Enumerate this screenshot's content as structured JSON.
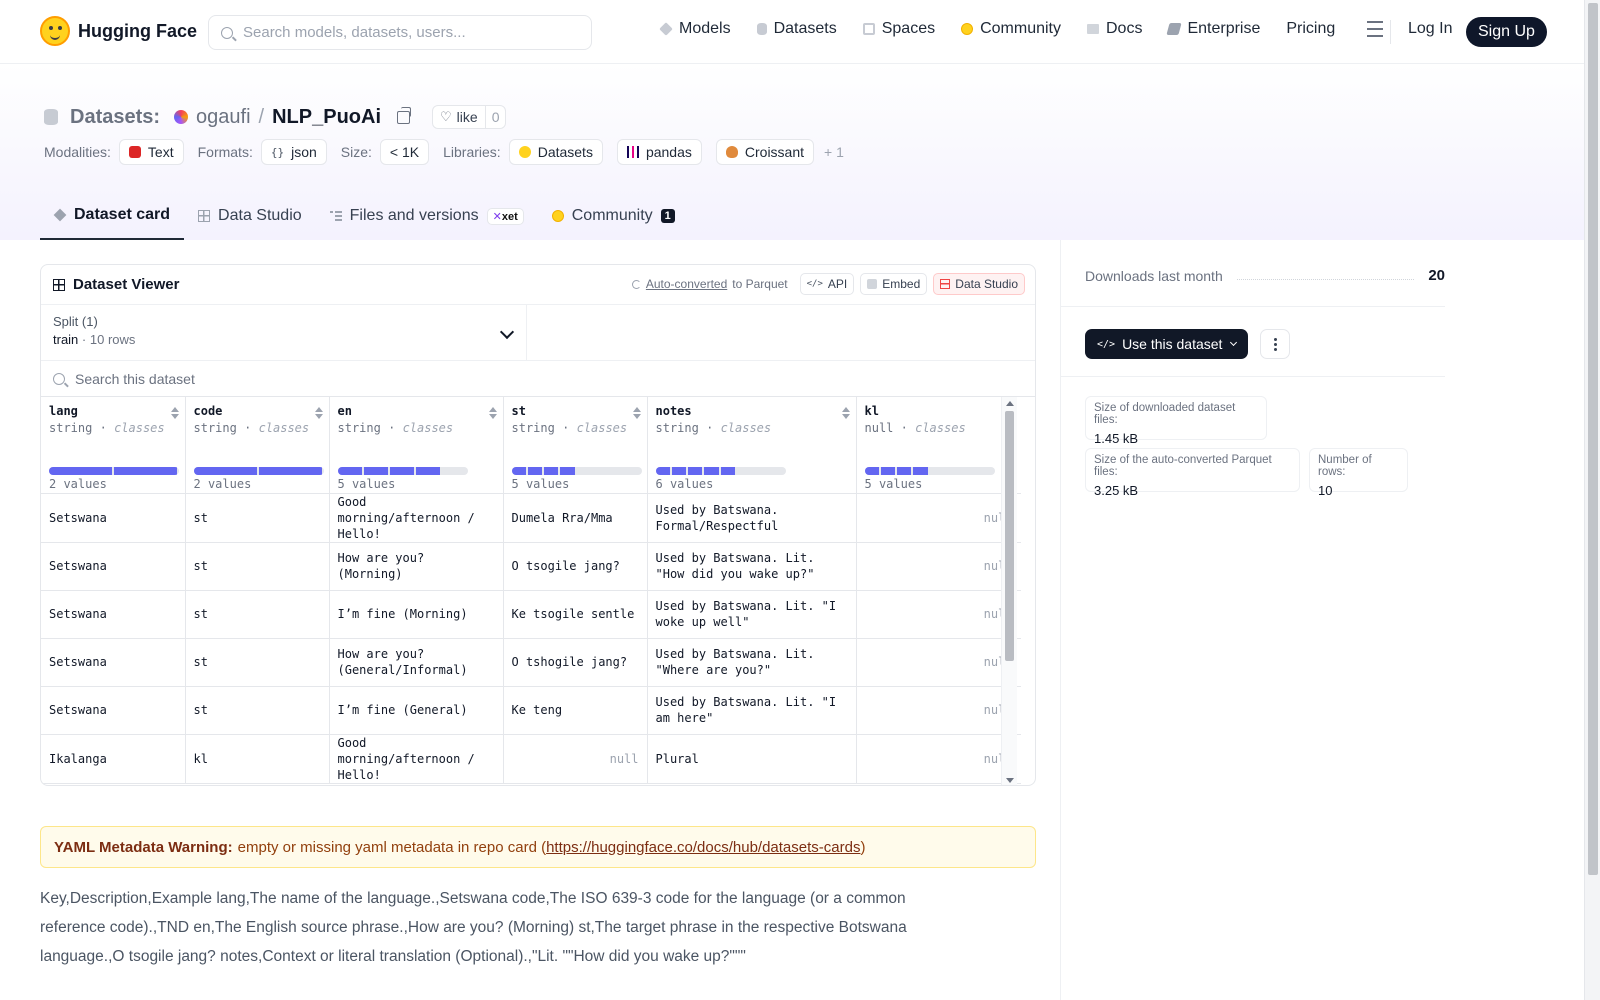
{
  "brand": {
    "name": "Hugging Face"
  },
  "search": {
    "placeholder": "Search models, datasets, users..."
  },
  "nav": {
    "links": [
      {
        "label": "Models",
        "icon": "cube-icon"
      },
      {
        "label": "Datasets",
        "icon": "database-icon"
      },
      {
        "label": "Spaces",
        "icon": "grid-icon"
      },
      {
        "label": "Community",
        "icon": "hf-face-icon"
      },
      {
        "label": "Docs",
        "icon": "book-icon"
      },
      {
        "label": "Enterprise",
        "icon": "building-icon"
      },
      {
        "label": "Pricing"
      }
    ],
    "login": "Log In",
    "signup": "Sign Up"
  },
  "repo": {
    "prefix": "Datasets:",
    "owner": "ogaufi",
    "separator": "/",
    "name": "NLP_PuoAi",
    "like_label": "like",
    "like_count": "0"
  },
  "tags": {
    "modalities_label": "Modalities:",
    "modalities": [
      "Text"
    ],
    "formats_label": "Formats:",
    "formats": [
      "json"
    ],
    "size_label": "Size:",
    "size": "< 1K",
    "libraries_label": "Libraries:",
    "libraries": [
      "Datasets",
      "pandas",
      "Croissant"
    ],
    "more": "+ 1"
  },
  "tabs": [
    {
      "label": "Dataset card",
      "active": true
    },
    {
      "label": "Data Studio"
    },
    {
      "label": "Files and versions",
      "badge": "xet"
    },
    {
      "label": "Community",
      "count": "1"
    }
  ],
  "viewer": {
    "title": "Dataset Viewer",
    "auto_converted": "Auto-converted",
    "to_parquet": "to Parquet",
    "api": "API",
    "embed": "Embed",
    "data_studio": "Data Studio",
    "split_label": "Split (1)",
    "split_value": "train",
    "split_sep": "·",
    "split_rows": "10 rows",
    "search_placeholder": "Search this dataset",
    "columns": [
      {
        "name": "lang",
        "type": "string",
        "kind": "classes",
        "values": "2 values",
        "segments": 2,
        "total": 2
      },
      {
        "name": "code",
        "type": "string",
        "kind": "classes",
        "values": "2 values",
        "segments": 2,
        "total": 2
      },
      {
        "name": "en",
        "type": "string",
        "kind": "classes",
        "values": "5 values",
        "segments": 4,
        "total": 5
      },
      {
        "name": "st",
        "type": "string",
        "kind": "classes",
        "values": "5 values",
        "segments": 4,
        "total": 8
      },
      {
        "name": "notes",
        "type": "string",
        "kind": "classes",
        "values": "6 values",
        "segments": 5,
        "total": 8
      },
      {
        "name": "kl",
        "type": "null",
        "kind": "classes",
        "values": "5 values",
        "segments": 4,
        "total": 8
      }
    ],
    "type_sep": "·",
    "rows": [
      [
        "Setswana",
        "st",
        "Good morning/afternoon / Hello!",
        "Dumela Rra/Mma",
        "Used by Batswana. Formal/Respectful",
        "null"
      ],
      [
        "Setswana",
        "st",
        "How are you? (Morning)",
        "O tsogile jang?",
        "Used by Batswana. Lit. \"How did you wake up?\"",
        "null"
      ],
      [
        "Setswana",
        "st",
        "I’m fine (Morning)",
        "Ke tsogile sentle",
        "Used by Batswana. Lit. \"I woke up well\"",
        "null"
      ],
      [
        "Setswana",
        "st",
        "How are you? (General/Informal)",
        "O tshogile jang?",
        "Used by Batswana. Lit. \"Where are you?\"",
        "null"
      ],
      [
        "Setswana",
        "st",
        "I’m fine (General)",
        "Ke teng",
        "Used by Batswana. Lit. \"I am here\"",
        "null"
      ],
      [
        "Ikalanga",
        "kl",
        "Good morning/afternoon / Hello!",
        "null",
        "Plural",
        "null"
      ]
    ]
  },
  "warning": {
    "title": "YAML Metadata Warning:",
    "text": "empty or missing yaml metadata in repo card (",
    "link": "https://huggingface.co/docs/hub/datasets-cards",
    "close": ")"
  },
  "card_text": "Key,Description,Example lang,The name of the language.,Setswana code,The ISO 639-3 code for the language (or a common reference code).,TND en,The English source phrase.,How are you? (Morning) st,The target phrase in the respective Botswana language.,O tsogile jang? notes,Context or literal translation (Optional).,\"Lit. \"\"How did you wake up?\"\"\"",
  "sidebar": {
    "downloads_label": "Downloads last month",
    "downloads_value": "20",
    "use_dataset": "Use this dataset",
    "download_size_label": "Size of downloaded dataset files:",
    "download_size": "1.45 kB",
    "parquet_size_label": "Size of the auto-converted Parquet files:",
    "parquet_size": "3.25 kB",
    "rows_label": "Number of rows:",
    "rows": "10"
  }
}
